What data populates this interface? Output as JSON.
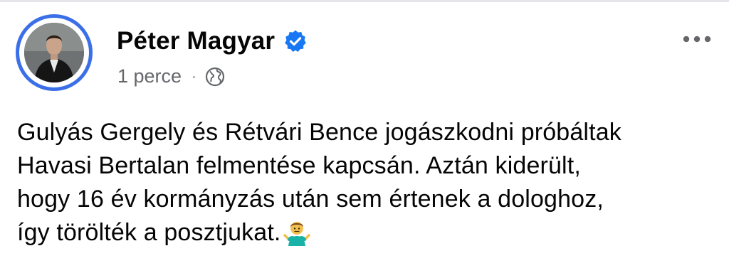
{
  "post": {
    "author": "Péter Magyar",
    "time": "1 perce",
    "separator": "·",
    "audience_icon": "globe-icon",
    "verified_icon": "verified-badge-icon",
    "more_icon": "more-options-icon",
    "text_lines": [
      "Gulyás Gergely és Rétvári Bence jogászkodni próbáltak",
      "Havasi Bertalan felmentése kapcsán. Aztán kiderült,",
      "hogy 16 év kormányzás után sem értenek a dologhoz,",
      "így törölték a posztjukat."
    ],
    "emoji": "shrugging-person-emoji"
  },
  "colors": {
    "accent_ring": "#3a6fe8",
    "verified": "#1877f2",
    "meta_text": "#65676b",
    "text": "#050505"
  }
}
